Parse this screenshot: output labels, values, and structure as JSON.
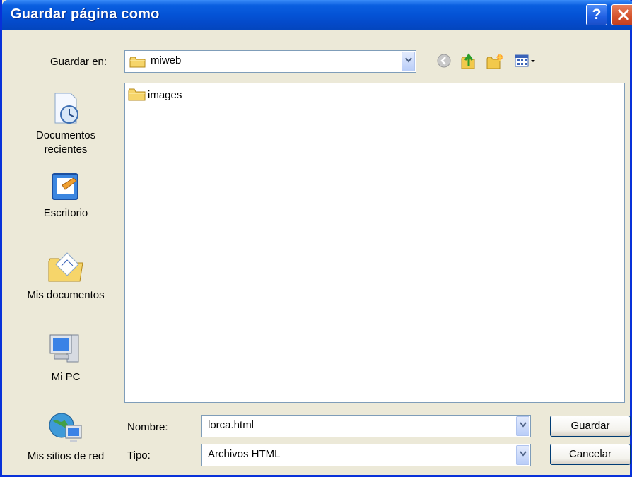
{
  "window": {
    "title": "Guardar página como"
  },
  "toolbar": {
    "save_in_label": "Guardar en:",
    "location_value": "miweb"
  },
  "places": [
    {
      "label_line1": "Documentos",
      "label_line2": "recientes",
      "icon": "recent-documents-icon"
    },
    {
      "label_line1": "Escritorio",
      "label_line2": "",
      "icon": "desktop-icon"
    },
    {
      "label_line1": "Mis documentos",
      "label_line2": "",
      "icon": "my-documents-icon"
    },
    {
      "label_line1": "Mi PC",
      "label_line2": "",
      "icon": "my-computer-icon"
    },
    {
      "label_line1": "Mis sitios de red",
      "label_line2": "",
      "icon": "network-places-icon"
    }
  ],
  "files": [
    {
      "name": "images",
      "type": "folder"
    }
  ],
  "form": {
    "name_label": "Nombre:",
    "name_value": "lorca.html",
    "type_label": "Tipo:",
    "type_value": "Archivos HTML"
  },
  "buttons": {
    "save": "Guardar",
    "cancel": "Cancelar"
  },
  "colors": {
    "titlebar": "#0453d6",
    "dialog_bg": "#ece9d8",
    "border": "#7f9db9"
  }
}
